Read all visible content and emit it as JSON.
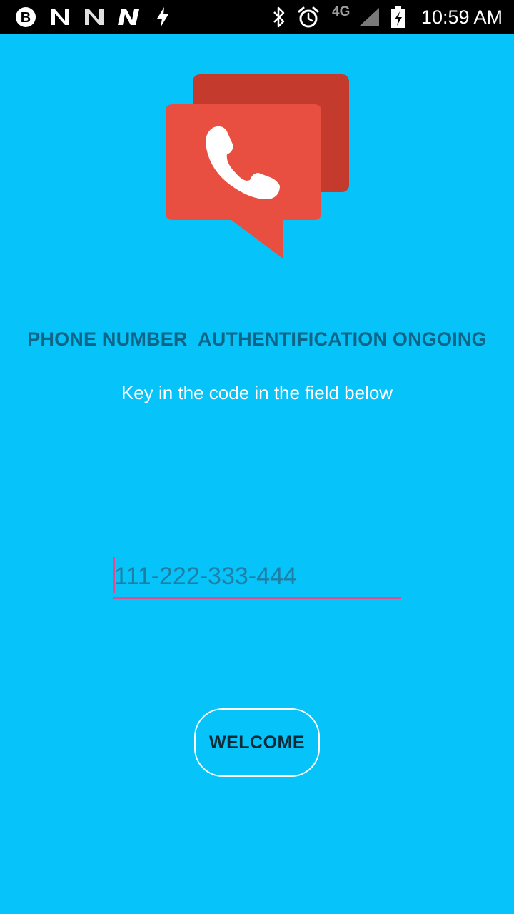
{
  "status_bar": {
    "time": "10:59 AM",
    "network_label": "4G",
    "icons": [
      "b-app-icon",
      "n-app-icon",
      "n-app-icon",
      "n-app-icon",
      "flash-icon",
      "bluetooth-icon",
      "alarm-icon",
      "signal-icon",
      "battery-charging-icon"
    ]
  },
  "logo": {
    "icon": "phone-chat-icon",
    "colors": {
      "back_bubble": "#C43A2D",
      "front_bubble": "#E94F40",
      "phone": "#FFFFFF"
    }
  },
  "main": {
    "headline": "PHONE NUMBER  AUTHENTIFICATION ONGOING",
    "subline": "Key in the code in the field below",
    "code_field": {
      "value": "",
      "placeholder": "111-222-333-444"
    },
    "welcome_button": "WELCOME"
  },
  "colors": {
    "background": "#06C3F9",
    "headline": "#0F6587",
    "accent": "#E64A8C"
  }
}
